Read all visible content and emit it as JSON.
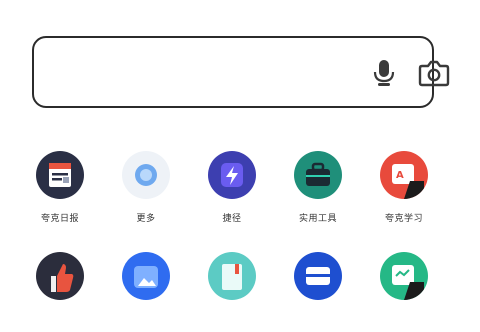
{
  "search": {
    "value": "",
    "placeholder": ""
  },
  "icons": {
    "mic": "microphone-icon",
    "camera": "camera-icon"
  },
  "apps_row1": [
    {
      "label": "夸克日报",
      "icon": "news-icon"
    },
    {
      "label": "更多",
      "icon": "more-icon"
    },
    {
      "label": "捷径",
      "icon": "shortcut-icon"
    },
    {
      "label": "实用工具",
      "icon": "toolbox-icon"
    },
    {
      "label": "夸克学习",
      "icon": "study-icon"
    }
  ],
  "apps_row2": [
    {
      "label": "",
      "icon": "thumb-up-icon"
    },
    {
      "label": "",
      "icon": "photo-folder-icon"
    },
    {
      "label": "",
      "icon": "notebook-icon"
    },
    {
      "label": "",
      "icon": "scanner-icon"
    },
    {
      "label": "",
      "icon": "doc-edit-icon"
    }
  ],
  "colors": {
    "news": "#2a2f45",
    "more": "#eef2f7",
    "shortcut": "#3d3fb0",
    "toolbox": "#1f8f7a",
    "study": "#e84a3c",
    "thumb": "#2b2d3c",
    "folder": "#2f6cf0",
    "notebook": "#5ccbc4",
    "scanner": "#1e4fd0",
    "docedit": "#25b886"
  }
}
